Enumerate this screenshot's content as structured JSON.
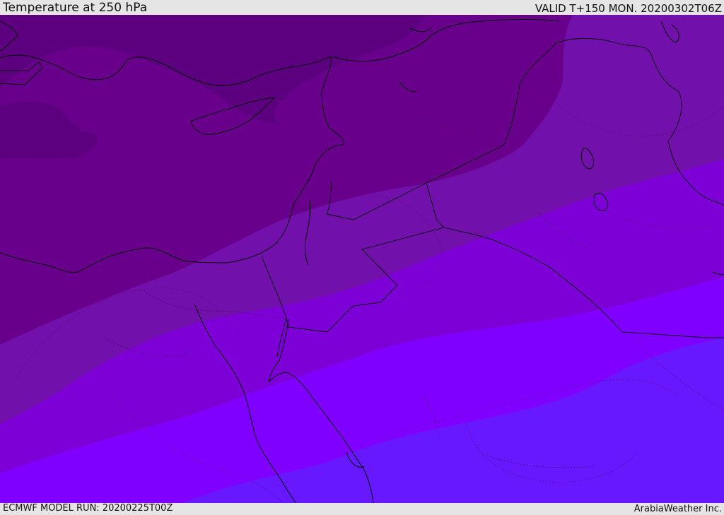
{
  "header": {
    "title": "Temperature at 250 hPa",
    "valid": "VALID T+150 MON. 20200302T06Z"
  },
  "footer": {
    "model_run": "ECMWF MODEL RUN: 20200225T00Z",
    "credit": "ArabiaWeather Inc."
  },
  "map": {
    "fill_colors": [
      "#5c0080",
      "#68008c",
      "#7210ab",
      "#7d00d6",
      "#8000ff",
      "#6818ff"
    ],
    "coastline_color": "#000000",
    "border_color": "#000000"
  }
}
